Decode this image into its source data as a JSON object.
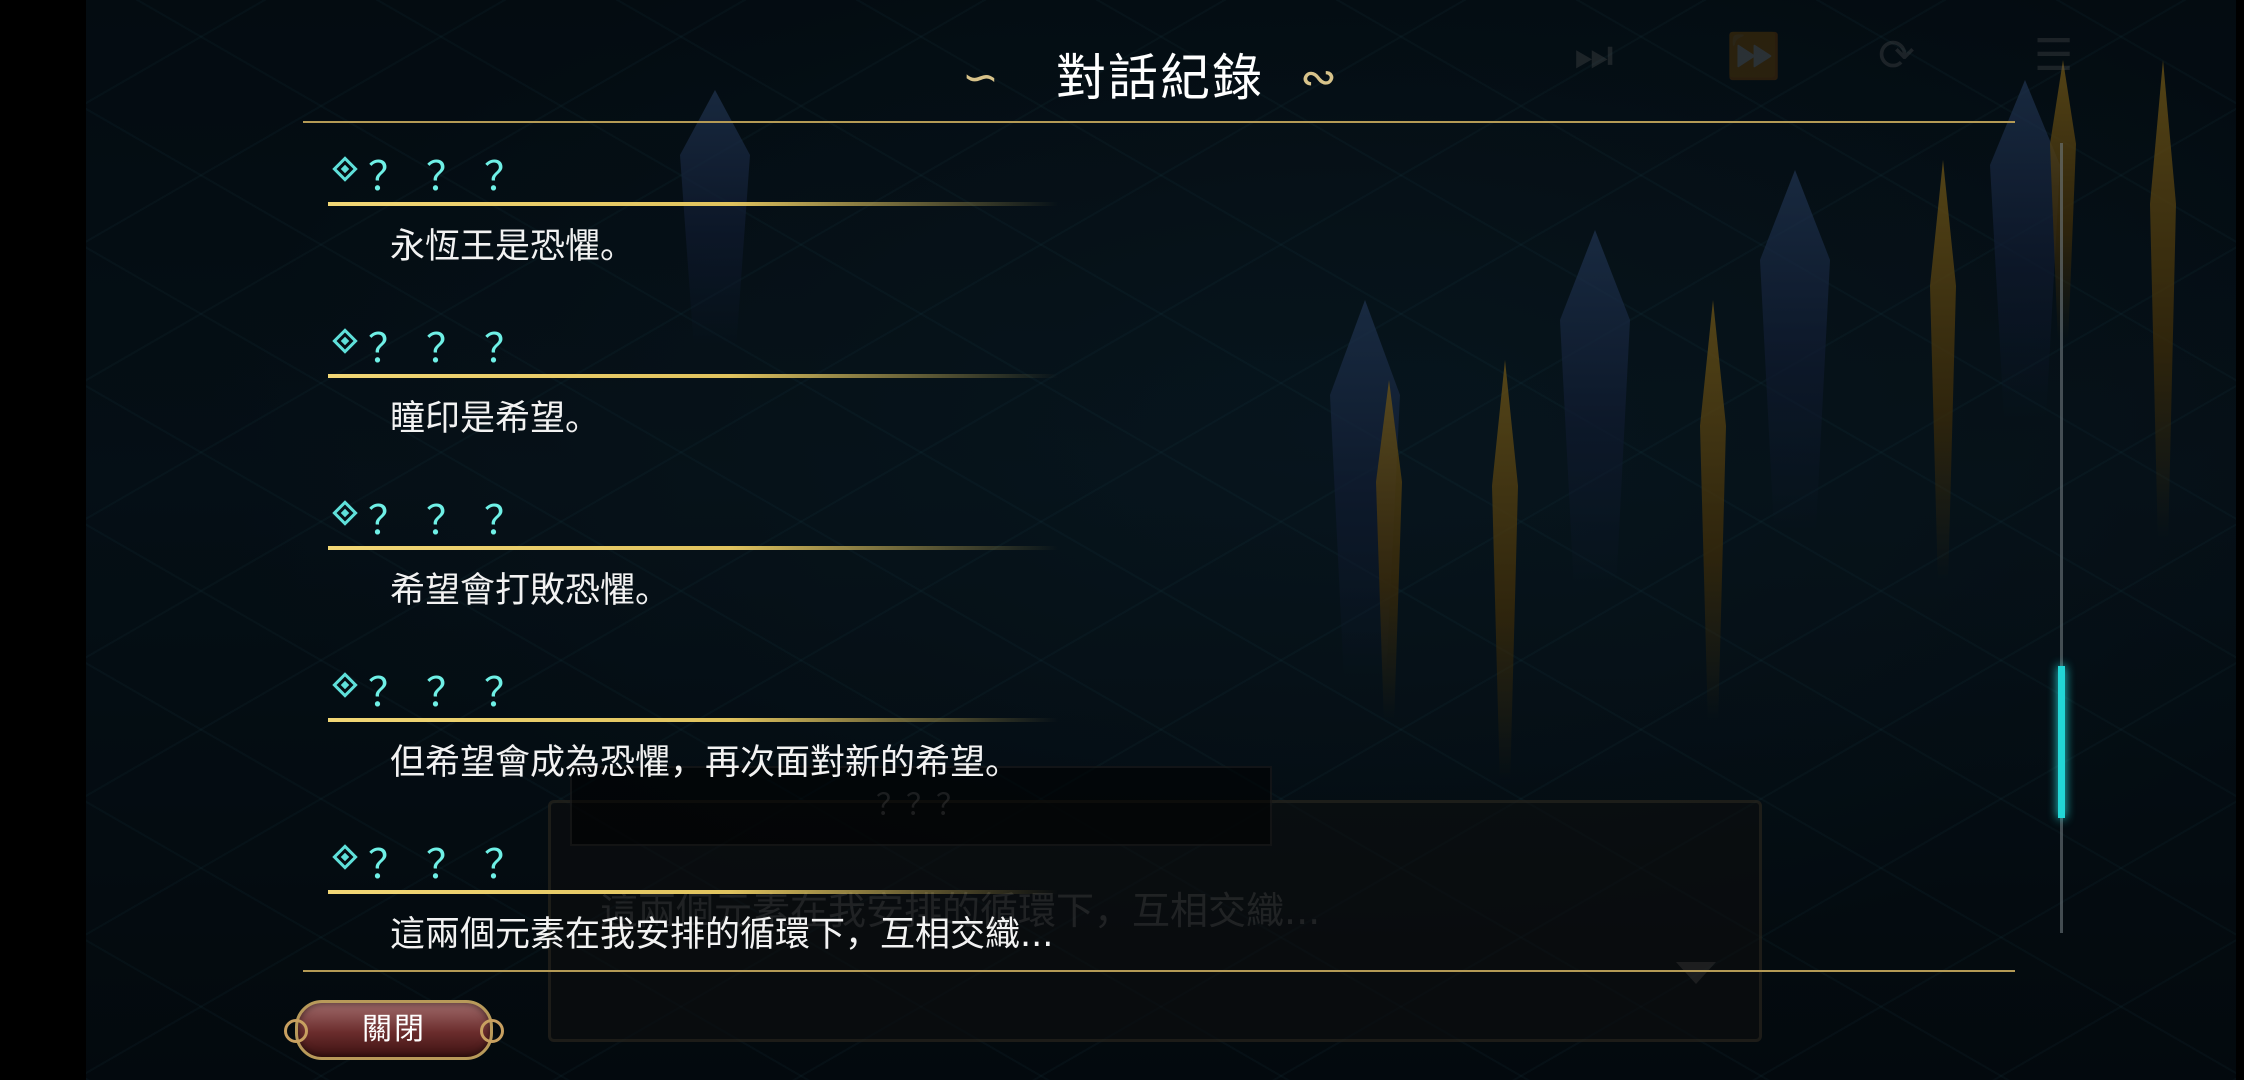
{
  "log": {
    "title": "對話紀錄",
    "entries": [
      {
        "speaker": "？？？",
        "text": "永恆王是恐懼。"
      },
      {
        "speaker": "？？？",
        "text": "瞳印是希望。"
      },
      {
        "speaker": "？？？",
        "text": "希望會打敗恐懼。"
      },
      {
        "speaker": "？？？",
        "text": "但希望會成為恐懼，再次面對新的希望。"
      },
      {
        "speaker": "？？？",
        "text": "這兩個元素在我安排的循環下，互相交織..."
      }
    ],
    "close_label": "關閉",
    "scroll_position": 0.82
  },
  "background_dialogue": {
    "speaker": "？？？",
    "text": "這兩個元素在我安排的循環下，互相交織..."
  },
  "controls": {
    "skip_icon": "fast-forward-skip-icon",
    "fast_icon": "fast-forward-icon",
    "auto_icon": "auto-play-icon",
    "log_icon": "log-icon"
  },
  "colors": {
    "speaker": "#6ff0e6",
    "accent_gold": "#e0c35e",
    "scroll_thumb": "#22d6d6"
  }
}
